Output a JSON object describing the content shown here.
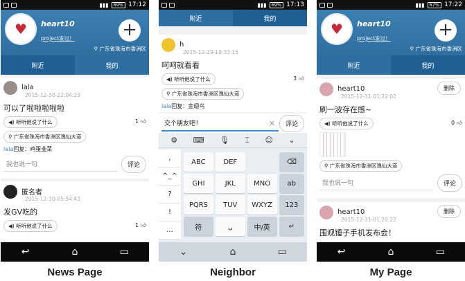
{
  "status": {
    "time1": "17:12",
    "time2": "17:13",
    "time3": "17:22",
    "battery1": "69%",
    "battery2": "69%",
    "battery3": "67%"
  },
  "profile": {
    "name": "heart10",
    "link": "project发过！",
    "location": "广东省珠海市香洲区"
  },
  "tabs": {
    "nearby": "附近",
    "mine": "我的"
  },
  "news": {
    "post1": {
      "name": "lala",
      "date": "2015-12-30-22:04:23",
      "text": "可以了啦啦啦啦啦",
      "listen": "听听他说了什么",
      "likes": "1",
      "location": "广东省珠海市香洲区逸仙大道",
      "reply_who": "lala",
      "reply_text": "回复：鸡蛋韭菜",
      "input_placeholder": "我也说一句",
      "comment_button": "评论"
    },
    "post2": {
      "name": "匿名者",
      "date": "2015-12-30-05:54:43",
      "text": "发GV吃的",
      "listen": "听听他说了什么",
      "likes": "1"
    }
  },
  "neighbor": {
    "post": {
      "name": "h",
      "date": "2015-12-29-19:33:15",
      "text": "呵呵就看看",
      "listen": "听听他说了什么",
      "likes": "3",
      "location": "广东省珠海市香洲区逸仙大道",
      "reply_who": "lala",
      "reply_text": "回复：金翅鸟"
    },
    "input_value": "交个朋友吧！",
    "comment_button": "评论",
    "keyboard": {
      "side": [
        ",",
        "^_^",
        "?",
        "!",
        "..."
      ],
      "rows": [
        [
          "ABC",
          "DEF",
          "⌫"
        ],
        [
          "GHI",
          "JKL",
          "MNO",
          "ab"
        ],
        [
          "PQRS",
          "TUV",
          "WXYZ",
          "123"
        ],
        [
          "符",
          "␣",
          "中/英",
          "↵"
        ]
      ]
    }
  },
  "my": {
    "post1": {
      "name": "heart10",
      "date": "2015-12-31-01:22:02",
      "text": "刷一波存在感~",
      "listen": "听听他说了什么",
      "likes": "0",
      "location": "广东省珠海市香洲区逸仙大道",
      "input_placeholder": "我也说一句",
      "comment_button": "评论",
      "delete_button": "删除"
    },
    "post2": {
      "name": "heart10",
      "date": "2015-12-31-01:20:22",
      "text": "围观锤子手机发布会！",
      "delete_button": "删除"
    }
  },
  "captions": {
    "news": "News Page",
    "neighbor": "Neighbor",
    "my": "My Page"
  }
}
